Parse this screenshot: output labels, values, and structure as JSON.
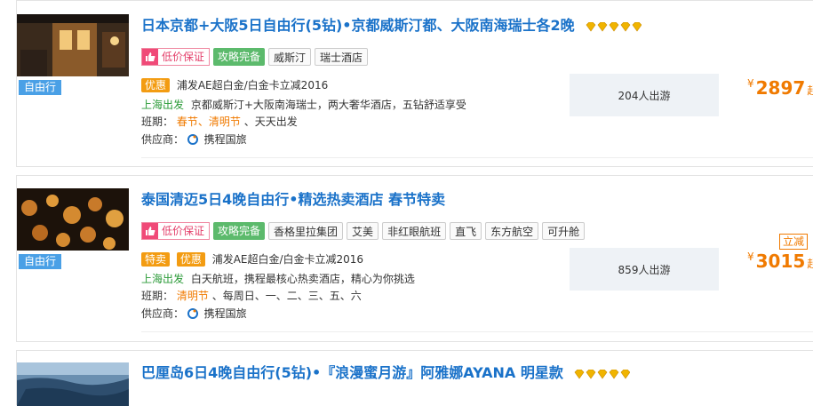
{
  "products": [
    {
      "category": "自由行",
      "title": "日本京都+大阪5日自由行(5钻)•京都威斯汀都、大阪南海瑞士各2晚",
      "diamonds": 5,
      "tags": [
        "低价保证",
        "攻略完备",
        "威斯汀",
        "瑞士酒店"
      ],
      "promo_badges": [
        "优惠"
      ],
      "promo_text": "浦发AE超白金/白金卡立减2016",
      "departure": "上海出发",
      "description": "京都威斯汀+大阪南海瑞士，两大奢华酒店，五钻舒适享受",
      "schedule_label": "班期：",
      "schedule_highlight": "春节、清明节",
      "schedule_rest": "、天天出发",
      "provider_label": "供应商：",
      "provider": "携程国旅",
      "sold": "204人出游",
      "currency": "¥",
      "price": "2897",
      "price_suffix": "起"
    },
    {
      "category": "自由行",
      "title": "泰国清迈5日4晚自由行•精选热卖酒店 春节特卖",
      "diamonds": 0,
      "tags": [
        "低价保证",
        "攻略完备",
        "香格里拉集团",
        "艾美",
        "非红眼航班",
        "直飞",
        "东方航空",
        "可升舱"
      ],
      "promo_badges": [
        "特卖",
        "优惠"
      ],
      "promo_text": "浦发AE超白金/白金卡立减2016",
      "departure": "上海出发",
      "description": "白天航班，携程最核心热卖酒店，精心为你挑选",
      "schedule_label": "班期：",
      "schedule_highlight": "清明节",
      "schedule_rest": "、每周日、一、二、三、五、六",
      "provider_label": "供应商：",
      "provider": "携程国旅",
      "sold": "859人出游",
      "discount_badge": "立减",
      "currency": "¥",
      "price": "3015",
      "price_suffix": "起"
    },
    {
      "title": "巴厘岛6日4晚自由行(5钻)•『浪漫蜜月游』阿雅娜AYANA 明星款",
      "diamonds": 5
    }
  ],
  "colors": {
    "title": "#1a72c9",
    "price": "#f07a00",
    "category_tag": "#4aa0e6",
    "guide_tag": "#5cba6c"
  }
}
